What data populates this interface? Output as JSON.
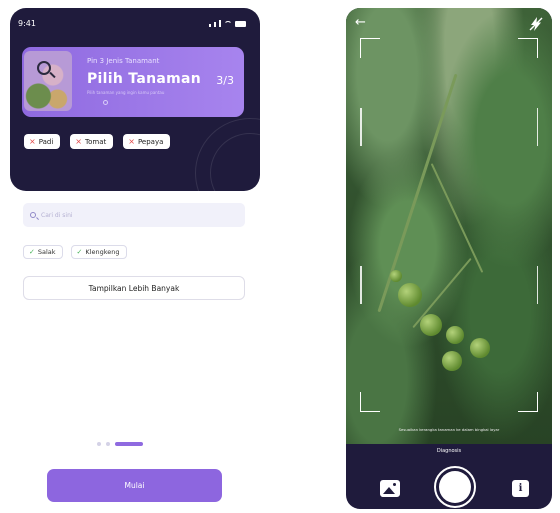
{
  "onboarding": {
    "status_time": "9:41",
    "banner": {
      "subtitle": "Pin 3 Jenis Tanamant",
      "title": "Pilih Tanaman",
      "description": "Pilih tanaman yang ingin kamu pantau",
      "step": "3/3"
    },
    "selected_chips": [
      {
        "label": "Padi"
      },
      {
        "label": "Tomat"
      },
      {
        "label": "Pepaya"
      }
    ],
    "search": {
      "placeholder": "Cari di sini"
    },
    "suggestions": [
      {
        "label": "Salak"
      },
      {
        "label": "Klengkeng"
      }
    ],
    "show_more_label": "Tampilkan Lebih Banyak",
    "pager": {
      "current": 3,
      "total": 3
    },
    "start_label": "Mulai"
  },
  "camera": {
    "hint": "Sesuaikan kerangka tanaman ke dalam bingkai layar",
    "mode_label": "Diagnosis",
    "info_label": "i",
    "icons": [
      "back-arrow-icon",
      "flash-off-icon",
      "gallery-icon",
      "shutter-icon",
      "info-icon"
    ]
  },
  "colors": {
    "dark": "#1f1b3c",
    "accent": "#8d66df",
    "remove_x": "#e24b4b",
    "check": "#49b35a"
  }
}
